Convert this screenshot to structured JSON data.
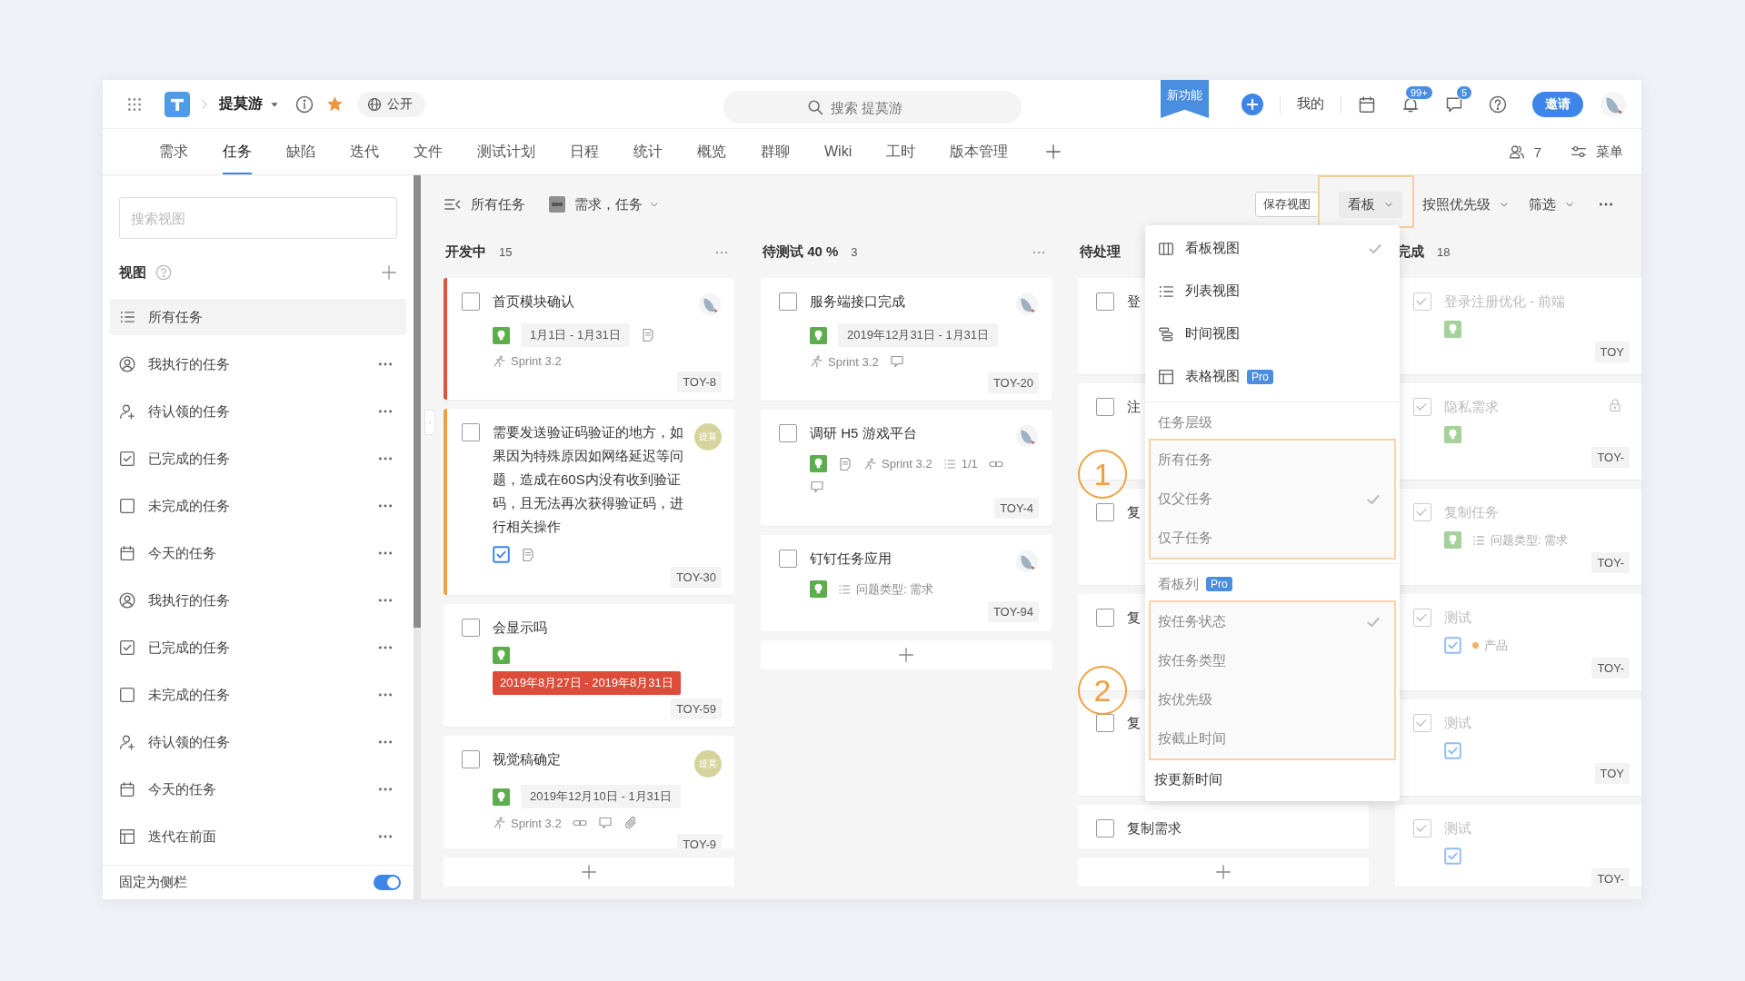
{
  "topbar": {
    "project": "提莫游",
    "visibility": "公开",
    "search": {
      "placeholder": "搜索 提莫游"
    },
    "new_feature": "新功能",
    "mine": "我的",
    "notifications_badge": "99+",
    "messages_badge": "5",
    "invite": "邀请"
  },
  "tabs": [
    {
      "label": "需求",
      "selected": false
    },
    {
      "label": "任务",
      "selected": true
    },
    {
      "label": "缺陷",
      "selected": false
    },
    {
      "label": "迭代",
      "selected": false
    },
    {
      "label": "文件",
      "selected": false
    },
    {
      "label": "测试计划",
      "selected": false
    },
    {
      "label": "日程",
      "selected": false
    },
    {
      "label": "统计",
      "selected": false
    },
    {
      "label": "概览",
      "selected": false
    },
    {
      "label": "群聊",
      "selected": false
    },
    {
      "label": "Wiki",
      "selected": false
    },
    {
      "label": "工时",
      "selected": false
    },
    {
      "label": "版本管理",
      "selected": false
    }
  ],
  "tab_actions": {
    "members": "7",
    "menu": "菜单"
  },
  "sidebar": {
    "search": {
      "placeholder": "搜索视图"
    },
    "heading": "视图",
    "items": [
      {
        "kind": "list",
        "label": "所有任务",
        "selected": true
      },
      {
        "kind": "user-circle",
        "label": "我执行的任务",
        "selected": false
      },
      {
        "kind": "user-plus",
        "label": "待认领的任务",
        "selected": false
      },
      {
        "kind": "check-square",
        "label": "已完成的任务",
        "selected": false
      },
      {
        "kind": "square",
        "label": "未完成的任务",
        "selected": false
      },
      {
        "kind": "calendar",
        "label": "今天的任务",
        "selected": false
      },
      {
        "kind": "user-circle",
        "label": "我执行的任务",
        "selected": false
      },
      {
        "kind": "check-square",
        "label": "已完成的任务",
        "selected": false
      },
      {
        "kind": "square",
        "label": "未完成的任务",
        "selected": false
      },
      {
        "kind": "user-plus",
        "label": "待认领的任务",
        "selected": false
      },
      {
        "kind": "calendar",
        "label": "今天的任务",
        "selected": false
      },
      {
        "kind": "table",
        "label": "迭代在前面",
        "selected": false
      }
    ],
    "pin": {
      "label": "固定为侧栏",
      "on": true
    }
  },
  "toolbar": {
    "view_name": "所有任务",
    "types": "需求，任务",
    "save": "保存视图",
    "view_mode": {
      "label": "看板",
      "highlighted": true
    },
    "sort": "按照优先级",
    "filter": "筛选"
  },
  "columns": [
    {
      "title": "开发中",
      "count": "15",
      "more": true,
      "add": true,
      "cards": [
        {
          "title": "首页模块确认",
          "checked": false,
          "locked": false,
          "color": "#e0523a",
          "avatar": {
            "kind": "image"
          },
          "meta": [
            [
              {
                "kind": "story"
              },
              {
                "kind": "date",
                "text": "1月1日 - 1月31日"
              },
              {
                "kind": "doc"
              }
            ],
            [
              {
                "kind": "sprint",
                "text": "Sprint 3.2"
              }
            ]
          ],
          "id": "TOY-8"
        },
        {
          "title": "需要发送验证码验证的地方，如果因为特殊原因如网络延迟等问题，造成在60S内没有收到验证码，且无法再次获得验证码，进行相关操作",
          "checked": false,
          "locked": false,
          "color": "#f0a040",
          "avatar": {
            "kind": "initials",
            "text": "提莫"
          },
          "meta": [
            [
              {
                "kind": "task"
              },
              {
                "kind": "doc"
              }
            ]
          ],
          "id": "TOY-30"
        },
        {
          "title": "会显示吗",
          "checked": false,
          "locked": false,
          "meta": [
            [
              {
                "kind": "story"
              }
            ],
            [
              {
                "kind": "date-overdue",
                "text": "2019年8月27日 - 2019年8月31日"
              }
            ]
          ],
          "id": "TOY-59"
        },
        {
          "title": "视觉稿确定",
          "checked": false,
          "locked": false,
          "avatar": {
            "kind": "initials",
            "text": "提莫"
          },
          "meta": [
            [
              {
                "kind": "story"
              },
              {
                "kind": "date",
                "text": "2019年12月10日 - 1月31日"
              }
            ],
            [
              {
                "kind": "sprint",
                "text": "Sprint 3.2"
              },
              {
                "kind": "link"
              },
              {
                "kind": "comment"
              },
              {
                "kind": "attachment"
              }
            ]
          ],
          "id": "TOY-9"
        }
      ]
    },
    {
      "title": "待测试 40 %",
      "count": "3",
      "more": true,
      "add": true,
      "cards": [
        {
          "title": "服务端接口完成",
          "checked": false,
          "locked": false,
          "avatar": {
            "kind": "image"
          },
          "meta": [
            [
              {
                "kind": "story"
              },
              {
                "kind": "date",
                "text": "2019年12月31日 - 1月31日"
              }
            ],
            [
              {
                "kind": "sprint",
                "text": "Sprint 3.2"
              },
              {
                "kind": "comment"
              }
            ]
          ],
          "id": "TOY-20"
        },
        {
          "title": "调研 H5 游戏平台",
          "checked": false,
          "locked": false,
          "avatar": {
            "kind": "image"
          },
          "meta": [
            [
              {
                "kind": "story"
              },
              {
                "kind": "doc"
              },
              {
                "kind": "sprint",
                "text": "Sprint 3.2"
              },
              {
                "kind": "subtasks",
                "text": "1/1"
              },
              {
                "kind": "link"
              }
            ],
            [
              {
                "kind": "comment"
              }
            ]
          ],
          "id": "TOY-4"
        },
        {
          "title": "钉钉任务应用",
          "checked": false,
          "locked": false,
          "avatar": {
            "kind": "image"
          },
          "meta": [
            [
              {
                "kind": "story"
              },
              {
                "kind": "field",
                "text": "问题类型: 需求"
              }
            ]
          ],
          "id": "TOY-94"
        }
      ]
    },
    {
      "title": "待处理",
      "more": false,
      "add": true,
      "cards": [
        {
          "title": "登",
          "checked": false,
          "locked": false
        },
        {
          "title": "注",
          "checked": false,
          "locked": false
        },
        {
          "title": "复",
          "checked": false,
          "locked": false
        },
        {
          "title": "复",
          "checked": false,
          "locked": false
        },
        {
          "title": "复",
          "checked": false,
          "locked": false
        },
        {
          "title": "复制需求",
          "checked": false,
          "locked": false
        }
      ]
    },
    {
      "title": "完成",
      "count": "18",
      "more": false,
      "add": false,
      "cards": [
        {
          "title": "登录注册优化 - 前端",
          "checked": true,
          "locked": false,
          "meta": [
            [
              {
                "kind": "story"
              }
            ]
          ],
          "id": "TOY"
        },
        {
          "title": "隐私需求",
          "checked": true,
          "locked": true,
          "meta": [
            [
              {
                "kind": "story"
              }
            ]
          ],
          "id": "TOY-"
        },
        {
          "title": "复制任务",
          "checked": true,
          "locked": false,
          "meta": [
            [
              {
                "kind": "story"
              },
              {
                "kind": "field",
                "text": "问题类型: 需求"
              }
            ]
          ],
          "id": "TOY-"
        },
        {
          "title": "测试",
          "checked": true,
          "locked": false,
          "meta": [
            [
              {
                "kind": "task"
              },
              {
                "kind": "tag",
                "text": "产品",
                "color": "#f0b36a"
              }
            ]
          ],
          "id": "TOY-"
        },
        {
          "title": "测试",
          "checked": true,
          "locked": false,
          "meta": [
            [
              {
                "kind": "task"
              }
            ]
          ],
          "id": "TOY"
        },
        {
          "title": "测试",
          "checked": true,
          "locked": false,
          "meta": [
            [
              {
                "kind": "task"
              }
            ]
          ],
          "id": "TOY-"
        }
      ]
    }
  ],
  "view_menu": {
    "items": [
      {
        "kind": "columns",
        "label": "看板视图",
        "selected": true
      },
      {
        "kind": "list",
        "label": "列表视图",
        "selected": false
      },
      {
        "kind": "timeline",
        "label": "时间视图",
        "selected": false
      },
      {
        "kind": "table",
        "label": "表格视图",
        "badge": "Pro",
        "selected": false
      }
    ],
    "sections": [
      {
        "title": "任务层级",
        "options": [
          {
            "label": "所有任务",
            "selected": false,
            "disabled": true,
            "highlighted": true
          },
          {
            "label": "仅父任务",
            "selected": true,
            "disabled": true,
            "highlighted": true
          },
          {
            "label": "仅子任务",
            "selected": false,
            "disabled": true,
            "highlighted": true
          }
        ]
      },
      {
        "title": "看板列",
        "badge": "Pro",
        "options": [
          {
            "label": "按任务状态",
            "selected": true,
            "disabled": true,
            "highlighted": true
          },
          {
            "label": "按任务类型",
            "selected": false,
            "disabled": true,
            "highlighted": true
          },
          {
            "label": "按优先级",
            "selected": false,
            "disabled": true,
            "highlighted": true
          },
          {
            "label": "按截止时间",
            "selected": false,
            "disabled": true,
            "highlighted": true
          },
          {
            "label": "按更新时间",
            "selected": false,
            "disabled": false,
            "highlighted": false
          }
        ]
      }
    ]
  },
  "annotations": [
    {
      "label": "1"
    },
    {
      "label": "2"
    }
  ]
}
